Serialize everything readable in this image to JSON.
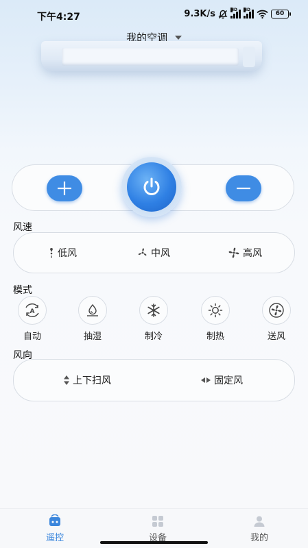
{
  "status_bar": {
    "time": "下午4:27",
    "network_speed": "9.3K/s",
    "battery": "60"
  },
  "header": {
    "device_name": "我的空调"
  },
  "temperature_control": {
    "increase_icon": "plus-icon",
    "power_icon": "power-icon",
    "decrease_icon": "minus-icon"
  },
  "fan_speed": {
    "title": "风速",
    "options": [
      {
        "label": "低风",
        "icon": "fan-low-icon"
      },
      {
        "label": "中风",
        "icon": "fan-mid-icon"
      },
      {
        "label": "高风",
        "icon": "fan-high-icon"
      }
    ]
  },
  "mode": {
    "title": "模式",
    "options": [
      {
        "label": "自动",
        "icon": "auto-mode-icon"
      },
      {
        "label": "抽湿",
        "icon": "dehumidify-icon"
      },
      {
        "label": "制冷",
        "icon": "snowflake-icon"
      },
      {
        "label": "制热",
        "icon": "sun-icon"
      },
      {
        "label": "送风",
        "icon": "fan-icon"
      }
    ]
  },
  "wind_direction": {
    "title": "风向",
    "options": [
      {
        "label": "上下扫风",
        "icon": "swing-vertical-icon"
      },
      {
        "label": "固定风",
        "icon": "fixed-direction-icon"
      }
    ]
  },
  "bottom_nav": {
    "items": [
      {
        "label": "遥控",
        "icon": "remote-icon",
        "active": true
      },
      {
        "label": "设备",
        "icon": "devices-grid-icon",
        "active": false
      },
      {
        "label": "我的",
        "icon": "profile-icon",
        "active": false
      }
    ]
  },
  "colors": {
    "accent": "#3b86dc",
    "button_blue": "#3f8ce4",
    "background_top": "#dbeaf8"
  }
}
